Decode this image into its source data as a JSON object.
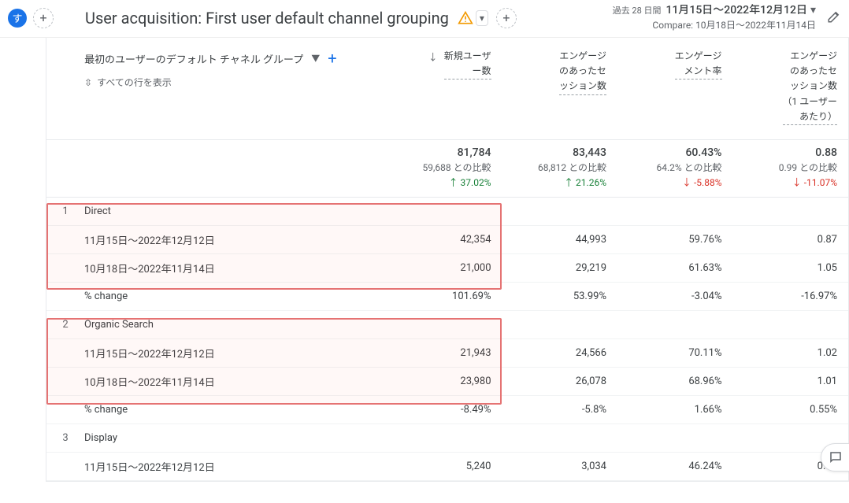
{
  "header": {
    "badge_char": "す",
    "title": "User acquisition: First user default channel grouping",
    "date_label": "過去 28 日間",
    "date_main": "11月15日～2022年12月12日",
    "date_compare": "Compare: 10月18日～2022年11月14日"
  },
  "dimension": {
    "label": "最初のユーザーのデフォルト チャネル グループ",
    "show_all": "すべての行を表示"
  },
  "metrics": {
    "col1": "新規ユーザ\nー数",
    "col2": "エンゲージ\nのあったセ\nッション数",
    "col3": "エンゲージ\nメント率",
    "col4": "エンゲージ\nのあったセ\nッション数\n（1 ユーザー\nあたり）"
  },
  "totals": {
    "col1": {
      "main": "81,784",
      "sub": "59,688 との比較",
      "delta": "↑ 37.02%",
      "dir": "up"
    },
    "col2": {
      "main": "83,443",
      "sub": "68,812 との比較",
      "delta": "↑ 21.26%",
      "dir": "up"
    },
    "col3": {
      "main": "60.43%",
      "sub": "64.2% との比較",
      "delta": "↓ -5.88%",
      "dir": "down"
    },
    "col4": {
      "main": "0.88",
      "sub": "0.99 との比較",
      "delta": "↓ -11.07%",
      "dir": "down"
    }
  },
  "rows": [
    {
      "idx": "1",
      "name": "Direct",
      "p1": {
        "label": "11月15日～2022年12月12日",
        "c1": "42,354",
        "c2": "44,993",
        "c3": "59.76%",
        "c4": "0.87"
      },
      "p2": {
        "label": "10月18日～2022年11月14日",
        "c1": "21,000",
        "c2": "29,219",
        "c3": "61.63%",
        "c4": "1.05"
      },
      "chg": {
        "label": "% change",
        "c1": "101.69%",
        "c2": "53.99%",
        "c3": "-3.04%",
        "c4": "-16.97%"
      }
    },
    {
      "idx": "2",
      "name": "Organic Search",
      "p1": {
        "label": "11月15日～2022年12月12日",
        "c1": "21,943",
        "c2": "24,566",
        "c3": "70.11%",
        "c4": "1.02"
      },
      "p2": {
        "label": "10月18日～2022年11月14日",
        "c1": "23,980",
        "c2": "26,078",
        "c3": "68.96%",
        "c4": "1.01"
      },
      "chg": {
        "label": "% change",
        "c1": "-8.49%",
        "c2": "-5.8%",
        "c3": "1.66%",
        "c4": "0.55%"
      }
    },
    {
      "idx": "3",
      "name": "Display",
      "p1": {
        "label": "11月15日～2022年12月12日",
        "c1": "5,240",
        "c2": "3,034",
        "c3": "46.24%",
        "c4": "0.57"
      }
    }
  ]
}
